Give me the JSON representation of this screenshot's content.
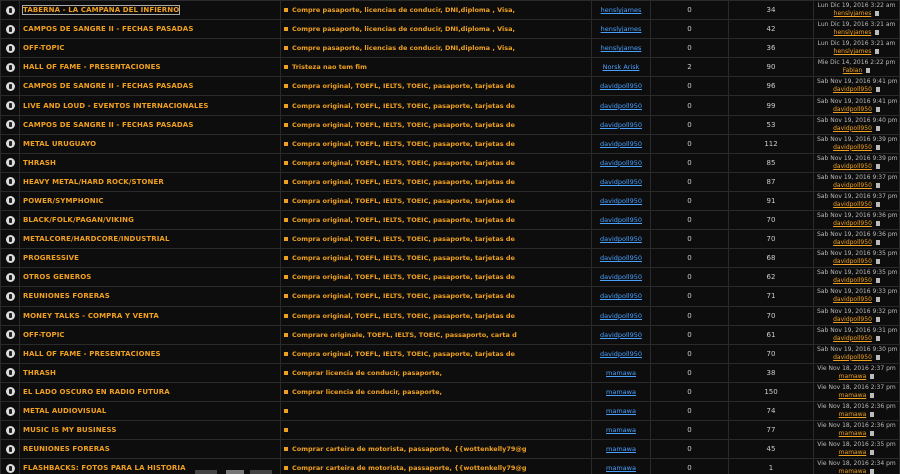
{
  "rows": [
    {
      "forum": "TABERNA - LA CAMPANA DEL INFIERNO",
      "topic": "Compre pasaporte, licencias de conducir, DNI,diploma , Visa,",
      "author": "henslyjames",
      "replies": "0",
      "views": "34",
      "date": "Lun Dic 19, 2016 3:22 am",
      "last_user": "henslyjames"
    },
    {
      "forum": "CAMPOS DE SANGRE II - FECHAS PASADAS",
      "topic": "Compre pasaporte, licencias de conducir, DNI,diploma , Visa,",
      "author": "henslyjames",
      "replies": "0",
      "views": "42",
      "date": "Lun Dic 19, 2016 3:21 am",
      "last_user": "henslyjames"
    },
    {
      "forum": "OFF-TOPIC",
      "topic": "Compre pasaporte, licencias de conducir, DNI,diploma , Visa,",
      "author": "henslyjames",
      "replies": "0",
      "views": "36",
      "date": "Lun Dic 19, 2016 3:21 am",
      "last_user": "henslyjames"
    },
    {
      "forum": "HALL OF FAME - PRESENTACIONES",
      "topic": "Tristeza nao tem fim",
      "author": "Norsk Arisk",
      "replies": "2",
      "views": "90",
      "date": "Mie Dic 14, 2016 2:22 pm",
      "last_user": "Fabian"
    },
    {
      "forum": "CAMPOS DE SANGRE II - FECHAS PASADAS",
      "topic": "Compra original, TOEFL, IELTS, TOEIC, pasaporte, tarjetas de",
      "author": "davidpoll950",
      "replies": "0",
      "views": "96",
      "date": "Sab Nov 19, 2016 9:41 pm",
      "last_user": "davidpoll950"
    },
    {
      "forum": "LIVE AND LOUD - EVENTOS INTERNACIONALES",
      "topic": "Compra original, TOEFL, IELTS, TOEIC, pasaporte, tarjetas de",
      "author": "davidpoll950",
      "replies": "0",
      "views": "99",
      "date": "Sab Nov 19, 2016 9:41 pm",
      "last_user": "davidpoll950"
    },
    {
      "forum": "CAMPOS DE SANGRE II - FECHAS PASADAS",
      "topic": "Compra original, TOEFL, IELTS, TOEIC, pasaporte, tarjetas de",
      "author": "davidpoll950",
      "replies": "0",
      "views": "53",
      "date": "Sab Nov 19, 2016 9:40 pm",
      "last_user": "davidpoll950"
    },
    {
      "forum": "METAL URUGUAYO",
      "topic": "Compra original, TOEFL, IELTS, TOEIC, pasaporte, tarjetas de",
      "author": "davidpoll950",
      "replies": "0",
      "views": "112",
      "date": "Sab Nov 19, 2016 9:39 pm",
      "last_user": "davidpoll950"
    },
    {
      "forum": "THRASH",
      "topic": "Compra original, TOEFL, IELTS, TOEIC, pasaporte, tarjetas de",
      "author": "davidpoll950",
      "replies": "0",
      "views": "85",
      "date": "Sab Nov 19, 2016 9:39 pm",
      "last_user": "davidpoll950"
    },
    {
      "forum": "HEAVY METAL/HARD ROCK/STONER",
      "topic": "Compra original, TOEFL, IELTS, TOEIC, pasaporte, tarjetas de",
      "author": "davidpoll950",
      "replies": "0",
      "views": "87",
      "date": "Sab Nov 19, 2016 9:37 pm",
      "last_user": "davidpoll950"
    },
    {
      "forum": "POWER/SYMPHONIC",
      "topic": "Compra original, TOEFL, IELTS, TOEIC, pasaporte, tarjetas de",
      "author": "davidpoll950",
      "replies": "0",
      "views": "91",
      "date": "Sab Nov 19, 2016 9:37 pm",
      "last_user": "davidpoll950"
    },
    {
      "forum": "BLACK/FOLK/PAGAN/VIKING",
      "topic": "Compra original, TOEFL, IELTS, TOEIC, pasaporte, tarjetas de",
      "author": "davidpoll950",
      "replies": "0",
      "views": "70",
      "date": "Sab Nov 19, 2016 9:36 pm",
      "last_user": "davidpoll950"
    },
    {
      "forum": "METALCORE/HARDCORE/INDUSTRIAL",
      "topic": "Compra original, TOEFL, IELTS, TOEIC, pasaporte, tarjetas de",
      "author": "davidpoll950",
      "replies": "0",
      "views": "70",
      "date": "Sab Nov 19, 2016 9:36 pm",
      "last_user": "davidpoll950"
    },
    {
      "forum": "PROGRESSIVE",
      "topic": "Compra original, TOEFL, IELTS, TOEIC, pasaporte, tarjetas de",
      "author": "davidpoll950",
      "replies": "0",
      "views": "68",
      "date": "Sab Nov 19, 2016 9:35 pm",
      "last_user": "davidpoll950"
    },
    {
      "forum": "OTROS GENEROS",
      "topic": "Compra original, TOEFL, IELTS, TOEIC, pasaporte, tarjetas de",
      "author": "davidpoll950",
      "replies": "0",
      "views": "62",
      "date": "Sab Nov 19, 2016 9:35 pm",
      "last_user": "davidpoll950"
    },
    {
      "forum": "REUNIONES FORERAS",
      "topic": "Compra original, TOEFL, IELTS, TOEIC, pasaporte, tarjetas de",
      "author": "davidpoll950",
      "replies": "0",
      "views": "71",
      "date": "Sab Nov 19, 2016 9:33 pm",
      "last_user": "davidpoll950"
    },
    {
      "forum": "MONEY TALKS - COMPRA Y VENTA",
      "topic": "Compra original, TOEFL, IELTS, TOEIC, pasaporte, tarjetas de",
      "author": "davidpoll950",
      "replies": "0",
      "views": "70",
      "date": "Sab Nov 19, 2016 9:32 pm",
      "last_user": "davidpoll950"
    },
    {
      "forum": "OFF-TOPIC",
      "topic": "Comprare originale, TOEFL, IELTS, TOEIC, passaporto, carta d",
      "author": "davidpoll950",
      "replies": "0",
      "views": "61",
      "date": "Sab Nov 19, 2016 9:31 pm",
      "last_user": "davidpoll950"
    },
    {
      "forum": "HALL OF FAME - PRESENTACIONES",
      "topic": "Compra original, TOEFL, IELTS, TOEIC, pasaporte, tarjetas de",
      "author": "davidpoll950",
      "replies": "0",
      "views": "70",
      "date": "Sab Nov 19, 2016 9:30 pm",
      "last_user": "davidpoll950"
    },
    {
      "forum": "THRASH",
      "topic": "Comprar licencia de conducir, pasaporte,",
      "author": "mamawa",
      "replies": "0",
      "views": "38",
      "date": "Vie Nov 18, 2016 2:37 pm",
      "last_user": "mamawa"
    },
    {
      "forum": "EL LADO OSCURO EN RADIO FUTURA",
      "topic": "Comprar licencia de conducir, pasaporte,",
      "author": "mamawa",
      "replies": "0",
      "views": "150",
      "date": "Vie Nov 18, 2016 2:37 pm",
      "last_user": "mamawa"
    },
    {
      "forum": "METAL AUDIOVISUAL",
      "topic": "",
      "author": "mamawa",
      "replies": "0",
      "views": "74",
      "date": "Vie Nov 18, 2016 2:36 pm",
      "last_user": "mamawa"
    },
    {
      "forum": "MUSIC IS MY BUSINESS",
      "topic": "",
      "author": "mamawa",
      "replies": "0",
      "views": "77",
      "date": "Vie Nov 18, 2016 2:36 pm",
      "last_user": "mamawa"
    },
    {
      "forum": "REUNIONES FORERAS",
      "topic": "Comprar carteira de motorista, passaporte, {{wottenkelly79@g",
      "author": "mamawa",
      "replies": "0",
      "views": "45",
      "date": "Vie Nov 18, 2016 2:35 pm",
      "last_user": "mamawa"
    },
    {
      "forum": "FLASHBACKS: FOTOS PARA LA HISTORIA",
      "topic": "Comprar carteira de motorista, passaporte, {{wottenkelly79@g",
      "author": "mamawa",
      "replies": "0",
      "views": "1",
      "date": "Vie Nov 18, 2016 2:34 pm",
      "last_user": "mamawa"
    }
  ],
  "colors": {
    "forum_link": "#f0a020",
    "author_link": "#4aa0ff",
    "background": "#000000",
    "row_bg": "#0d0d0d"
  }
}
